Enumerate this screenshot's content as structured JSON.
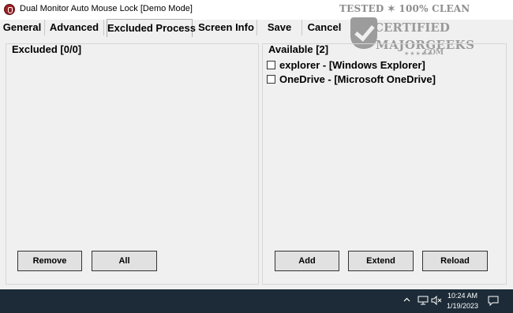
{
  "window": {
    "title": "Dual Monitor Auto Mouse Lock [Demo Mode]"
  },
  "watermark": {
    "line1": "TESTED ✶ 100% CLEAN",
    "line2": "CERTIFIED",
    "line3": "MAJORGEEKS",
    "stars": "★★★★★",
    "line4": ".COM"
  },
  "tabs": [
    {
      "label": "General",
      "active": false
    },
    {
      "label": "Advanced",
      "active": false
    },
    {
      "label": "Excluded Process",
      "active": true
    },
    {
      "label": "Screen Info",
      "active": false
    },
    {
      "label": "Save",
      "active": false
    },
    {
      "label": "Cancel",
      "active": false
    }
  ],
  "excluded": {
    "title": "Excluded [0/0]",
    "items": [],
    "buttons": {
      "remove": "Remove",
      "all": "All"
    }
  },
  "available": {
    "title": "Available [2]",
    "items": [
      {
        "label": "explorer - [Windows Explorer]",
        "checked": false
      },
      {
        "label": "OneDrive - [Microsoft OneDrive]",
        "checked": false
      }
    ],
    "buttons": {
      "add": "Add",
      "extend": "Extend",
      "reload": "Reload"
    }
  },
  "taskbar": {
    "time": "10:24 AM",
    "date": "1/19/2023",
    "icons": [
      "chevron-up-icon",
      "network-icon",
      "volume-muted-icon",
      "notification-icon"
    ]
  },
  "colors": {
    "taskbar": "#1c2b37",
    "window_bg": "#f0f0f0",
    "app_icon": "#9b2226"
  }
}
